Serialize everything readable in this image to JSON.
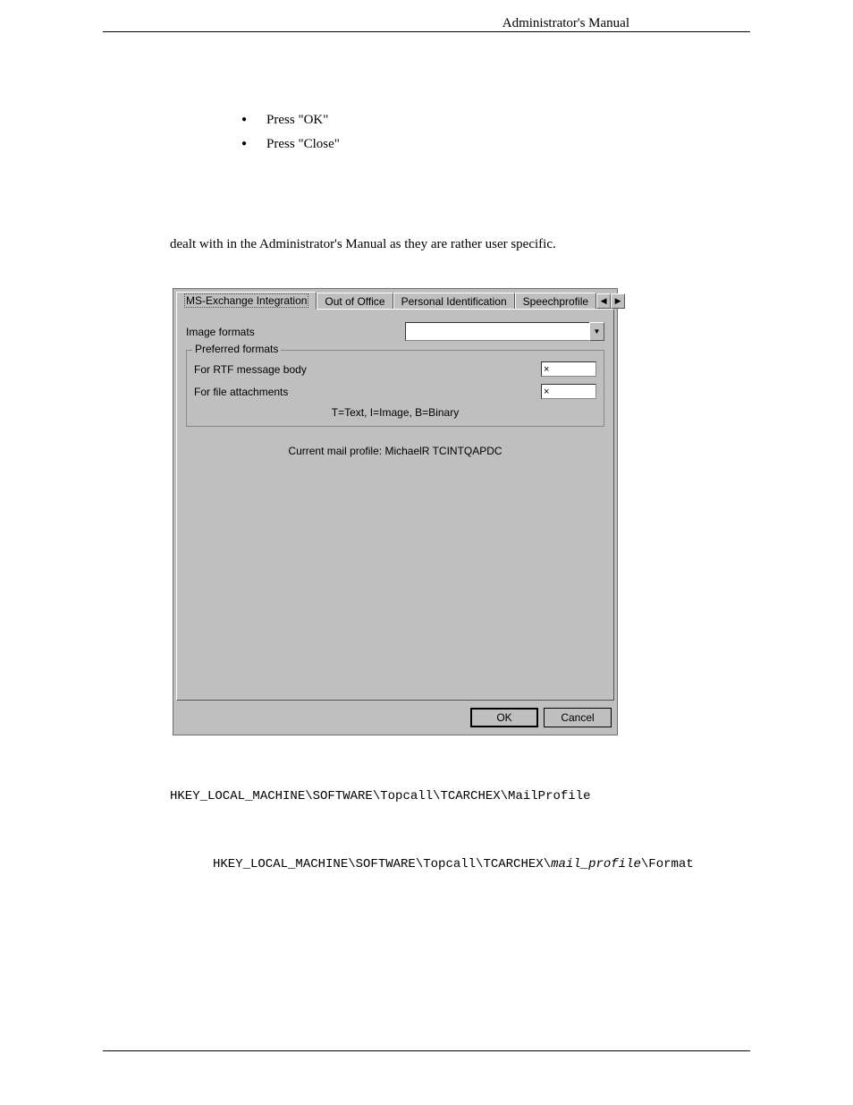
{
  "header": {
    "title": "Administrator's Manual"
  },
  "bullets": [
    "Press \"OK\"",
    "Press \"Close\""
  ],
  "paragraph": "dealt with in the Administrator's Manual as they are rather user specific.",
  "dialog": {
    "tabs": [
      "MS-Exchange Integration",
      "Out of Office",
      "Personal Identification",
      "Speechprofile"
    ],
    "active_tab": 0,
    "image_formats_label": "Image formats",
    "image_formats_value": "",
    "group_title": "Preferred formats",
    "rtf_label": "For RTF message body",
    "rtf_value": "×",
    "attach_label": "For file attachments",
    "attach_value": "×",
    "legend": "T=Text, I=Image, B=Binary",
    "profile": "Current mail profile: MichaelR TCINTQAPDC",
    "ok": "OK",
    "cancel": "Cancel"
  },
  "regpath1": "HKEY_LOCAL_MACHINE\\SOFTWARE\\Topcall\\TCARCHEX\\MailProfile",
  "regpath2_prefix": "HKEY_LOCAL_MACHINE\\SOFTWARE\\Topcall\\TCARCHEX\\",
  "regpath2_italic": "mail_profile",
  "regpath2_suffix": "\\Format"
}
